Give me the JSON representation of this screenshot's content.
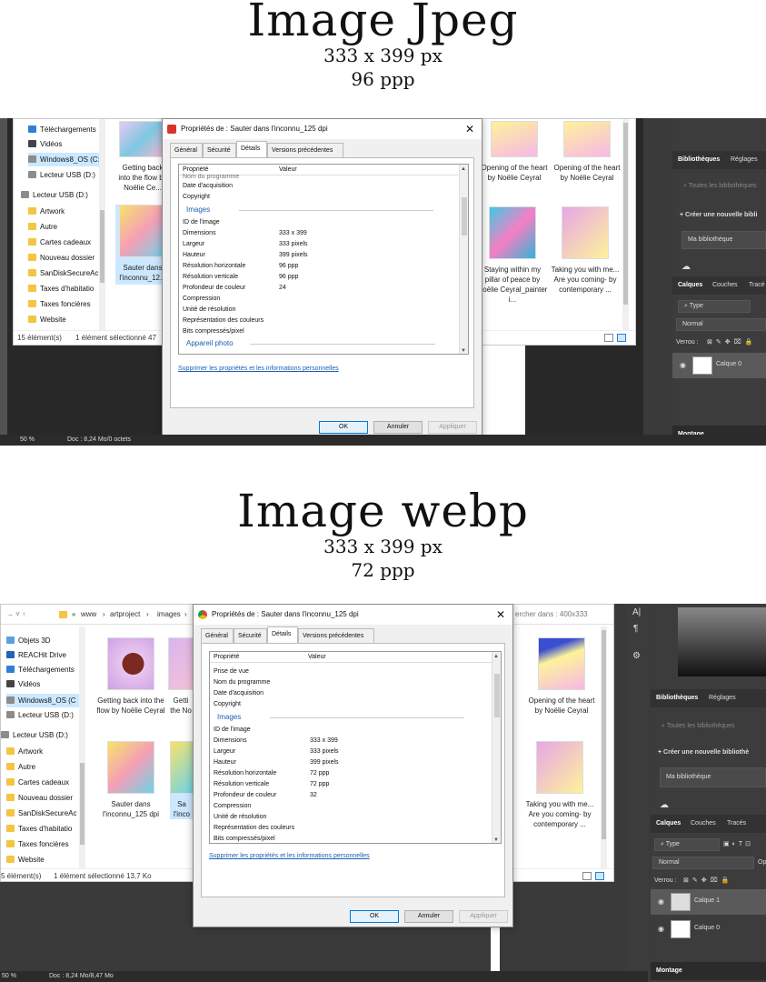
{
  "jpeg": {
    "title": "Image Jpeg",
    "dimensions": "333 x 399 px",
    "dpi": "96 ppp",
    "explorer": {
      "nav_items": [
        {
          "label": "Téléchargements",
          "icon": "download-icon"
        },
        {
          "label": "Vidéos",
          "icon": "video-icon"
        },
        {
          "label": "Windows8_OS (C:",
          "icon": "drive-icon",
          "selected": true
        },
        {
          "label": "Lecteur USB (D:)",
          "icon": "drive-icon"
        },
        {
          "label": "Lecteur USB (D:)",
          "icon": "drive-icon"
        },
        {
          "label": "Artwork",
          "icon": "folder-icon"
        },
        {
          "label": "Autre",
          "icon": "folder-icon"
        },
        {
          "label": "Cartes cadeaux",
          "icon": "folder-icon"
        },
        {
          "label": "Nouveau dossier",
          "icon": "folder-icon"
        },
        {
          "label": "SanDiskSecureAc",
          "icon": "folder-icon"
        },
        {
          "label": "Taxes d'habitatio",
          "icon": "folder-icon"
        },
        {
          "label": "Taxes foncières",
          "icon": "folder-icon"
        },
        {
          "label": "Website",
          "icon": "folder-icon"
        }
      ],
      "tiles": [
        {
          "caption": "Getting back into the flow by Noëlie Ce..."
        },
        {
          "caption": "Sauter dans l'inconnu_12..."
        },
        {
          "caption": "Opening of the heart by Noëlie Ceyral"
        },
        {
          "caption": "Opening of the heart by Noëlie Ceyral"
        },
        {
          "caption": "Staying within my pillar of peace by Noëlie Ceyral_painter i..."
        },
        {
          "caption": "Taking you with me... Are you coming- by contemporary ..."
        }
      ],
      "status_count": "15 élément(s)",
      "status_selected": "1 élément sélectionné  47"
    },
    "dialog": {
      "title": "Propriétés de : Sauter dans l'inconnu_125 dpi",
      "tabs": [
        "Général",
        "Sécurité",
        "Détails",
        "Versions précédentes"
      ],
      "col_property": "Propriété",
      "col_value": "Valeur",
      "rows_top": [
        {
          "k": "Nom du programme",
          "v": ""
        },
        {
          "k": "Date d'acquisition",
          "v": ""
        },
        {
          "k": "Copyright",
          "v": ""
        }
      ],
      "section_images": "Images",
      "rows_images": [
        {
          "k": "ID de l'image",
          "v": ""
        },
        {
          "k": "Dimensions",
          "v": "333 x 399"
        },
        {
          "k": "Largeur",
          "v": "333 pixels"
        },
        {
          "k": "Hauteur",
          "v": "399 pixels"
        },
        {
          "k": "Résolution horizontale",
          "v": "96 ppp"
        },
        {
          "k": "Résolution verticale",
          "v": "96 ppp"
        },
        {
          "k": "Profondeur de couleur",
          "v": "24"
        },
        {
          "k": "Compression",
          "v": ""
        },
        {
          "k": "Unité de résolution",
          "v": ""
        },
        {
          "k": "Représentation des couleurs",
          "v": ""
        },
        {
          "k": "Bits compressés/pixel",
          "v": ""
        }
      ],
      "section_photo": "Appareil photo",
      "link": "Supprimer les propriétés et les informations personnelles",
      "ok": "OK",
      "cancel": "Annuler",
      "apply": "Appliquer"
    },
    "ps": {
      "tab_libraries": "Bibliothèques",
      "tab_settings": "Réglages",
      "search_placeholder": "Toutes les bibliothèques",
      "create_library": "Créer une nouvelle bibli",
      "my_library": "Ma bibliothèque",
      "tab_layers": "Calques",
      "tab_channels": "Couches",
      "tab_paths": "Tracé",
      "filter_type": "Type",
      "blend_mode": "Normal",
      "lock_label": "Verrou :",
      "layers": [
        {
          "name": "Calque 0",
          "selected": true
        }
      ],
      "montage": "Montage",
      "zoom": "50 %",
      "doc_info": "Doc : 8,24 Mo/0 octets"
    }
  },
  "webp": {
    "title": "Image webp",
    "dimensions": "333 x 399 px",
    "dpi": "72 ppp",
    "explorer": {
      "path": [
        "«",
        "www",
        "›",
        "artproject",
        "›",
        "images",
        "›"
      ],
      "search_hint": "ercher dans : 400x333",
      "nav_items": [
        {
          "label": "Objets 3D",
          "icon": "cube-icon"
        },
        {
          "label": "REACHit Drive",
          "icon": "cloud-drive-icon"
        },
        {
          "label": "Téléchargements",
          "icon": "download-icon"
        },
        {
          "label": "Vidéos",
          "icon": "video-icon"
        },
        {
          "label": "Windows8_OS (C",
          "icon": "drive-icon",
          "selected": true
        },
        {
          "label": "Lecteur USB (D:)",
          "icon": "drive-icon"
        },
        {
          "label": "Lecteur USB (D:)",
          "icon": "drive-icon"
        },
        {
          "label": "Artwork",
          "icon": "folder-icon"
        },
        {
          "label": "Autre",
          "icon": "folder-icon"
        },
        {
          "label": "Cartes cadeaux",
          "icon": "folder-icon"
        },
        {
          "label": "Nouveau dossier",
          "icon": "folder-icon"
        },
        {
          "label": "SanDiskSecureAc",
          "icon": "folder-icon"
        },
        {
          "label": "Taxes d'habitatio",
          "icon": "folder-icon"
        },
        {
          "label": "Taxes foncières",
          "icon": "folder-icon"
        },
        {
          "label": "Website",
          "icon": "folder-icon"
        }
      ],
      "tiles": [
        {
          "caption": "Getting back into the flow by Noëlie Ceyral"
        },
        {
          "caption": "Getti the No"
        },
        {
          "caption": "Opening of the heart by Noëlie Ceyral"
        },
        {
          "caption": "Sauter dans l'inconnu_125 dpi"
        },
        {
          "caption": "Sa l'inco"
        },
        {
          "caption": "Taking you with me... Are you coming- by contemporary ..."
        }
      ],
      "status_count": "5 élément(s)",
      "status_selected": "1 élément sélectionné  13,7 Ko"
    },
    "dialog": {
      "title": "Propriétés de : Sauter dans l'inconnu_125 dpi",
      "tabs": [
        "Général",
        "Sécurité",
        "Détails",
        "Versions précédentes"
      ],
      "col_property": "Propriété",
      "col_value": "Valeur",
      "rows_top": [
        {
          "k": "Prise de vue",
          "v": ""
        },
        {
          "k": "Nom du programme",
          "v": ""
        },
        {
          "k": "Date d'acquisition",
          "v": ""
        },
        {
          "k": "Copyright",
          "v": ""
        }
      ],
      "section_images": "Images",
      "rows_images": [
        {
          "k": "ID de l'image",
          "v": ""
        },
        {
          "k": "Dimensions",
          "v": "333 x 399"
        },
        {
          "k": "Largeur",
          "v": "333 pixels"
        },
        {
          "k": "Hauteur",
          "v": "399 pixels"
        },
        {
          "k": "Résolution horizontale",
          "v": "72 ppp"
        },
        {
          "k": "Résolution verticale",
          "v": "72 ppp"
        },
        {
          "k": "Profondeur de couleur",
          "v": "32"
        },
        {
          "k": "Compression",
          "v": ""
        },
        {
          "k": "Unité de résolution",
          "v": ""
        },
        {
          "k": "Représentation des couleurs",
          "v": ""
        },
        {
          "k": "Bits compressés/pixel",
          "v": ""
        }
      ],
      "link": "Supprimer les propriétés et les informations personnelles",
      "ok": "OK",
      "cancel": "Annuler",
      "apply": "Appliquer"
    },
    "ps": {
      "tab_libraries": "Bibliothèques",
      "tab_settings": "Réglages",
      "search_placeholder": "Toutes les bibliothèques",
      "create_library": "Créer une nouvelle bibliothè",
      "my_library": "Ma bibliothèque",
      "tab_layers": "Calques",
      "tab_channels": "Couches",
      "tab_paths": "Tracés",
      "filter_type": "Type",
      "blend_mode": "Normal",
      "opacity_label": "Op",
      "lock_label": "Verrou :",
      "layers": [
        {
          "name": "Calque 1",
          "selected": true
        },
        {
          "name": "Calque 0",
          "selected": false
        }
      ],
      "montage": "Montage",
      "zoom": "50 %",
      "doc_info": "Doc : 8,24 Mo/8,47 Mo"
    }
  },
  "colors": {
    "ps_dark": "#3a3a3a",
    "dialog_bg": "#f0f0f0",
    "link": "#1a5fb4",
    "selection": "#cce8ff"
  }
}
